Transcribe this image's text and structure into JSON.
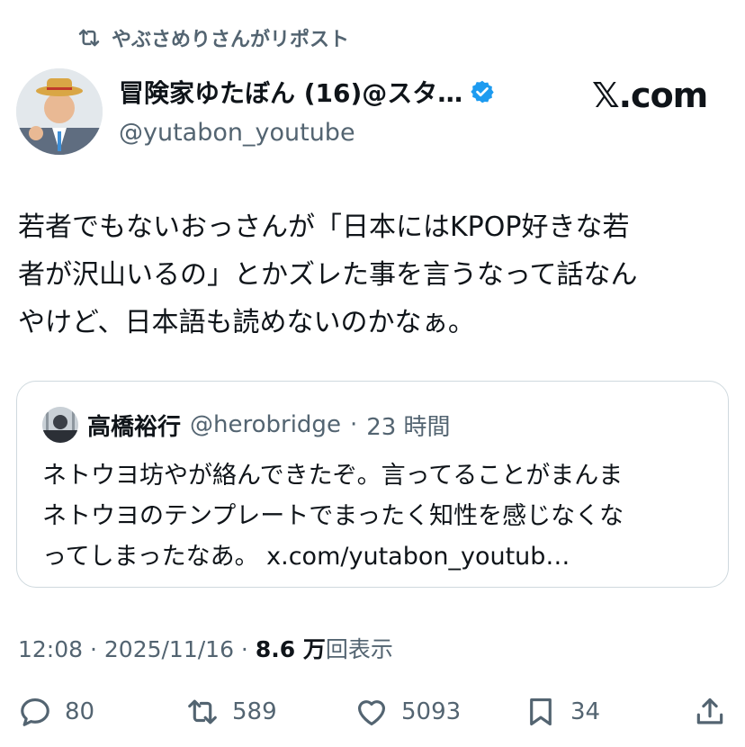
{
  "repost": {
    "icon": "repost-icon",
    "label": "やぶさめりさんがリポスト"
  },
  "author": {
    "display_name": "冒険家ゆたぼん (16)@スタ…",
    "handle": "@yutabon_youtube",
    "verified_icon": "verified-badge-icon",
    "avatar_icon": "avatar"
  },
  "brand": {
    "label": "𝕏.com"
  },
  "tweet": {
    "lines": [
      "若者でもないおっさんが「日本にはKPOP好きな若",
      "者が沢山いるの」とかズレた事を言うなって話なん",
      "やけど、日本語も読めないのかなぁ。"
    ]
  },
  "quote": {
    "name": "高橋裕行",
    "handle": "@herobridge",
    "separator": "·",
    "time": "23 時間",
    "lines": [
      "ネトウヨ坊やが絡んできたぞ。言ってることがまんま",
      "ネトウヨのテンプレートでまったく知性を感じなくな",
      "ってしまったなあ。 x.com/yutabon_youtub…"
    ]
  },
  "meta": {
    "time": "12:08",
    "sep": " · ",
    "date": "2025/11/16",
    "views_value": "8.6 万",
    "views_label": "回表示"
  },
  "actions": {
    "replies": "80",
    "reposts": "589",
    "likes": "5093",
    "bookmarks": "34"
  },
  "colors": {
    "text": "#0f1419",
    "muted": "#536471",
    "verified": "#1d9bf0",
    "border": "#cfd9de"
  }
}
